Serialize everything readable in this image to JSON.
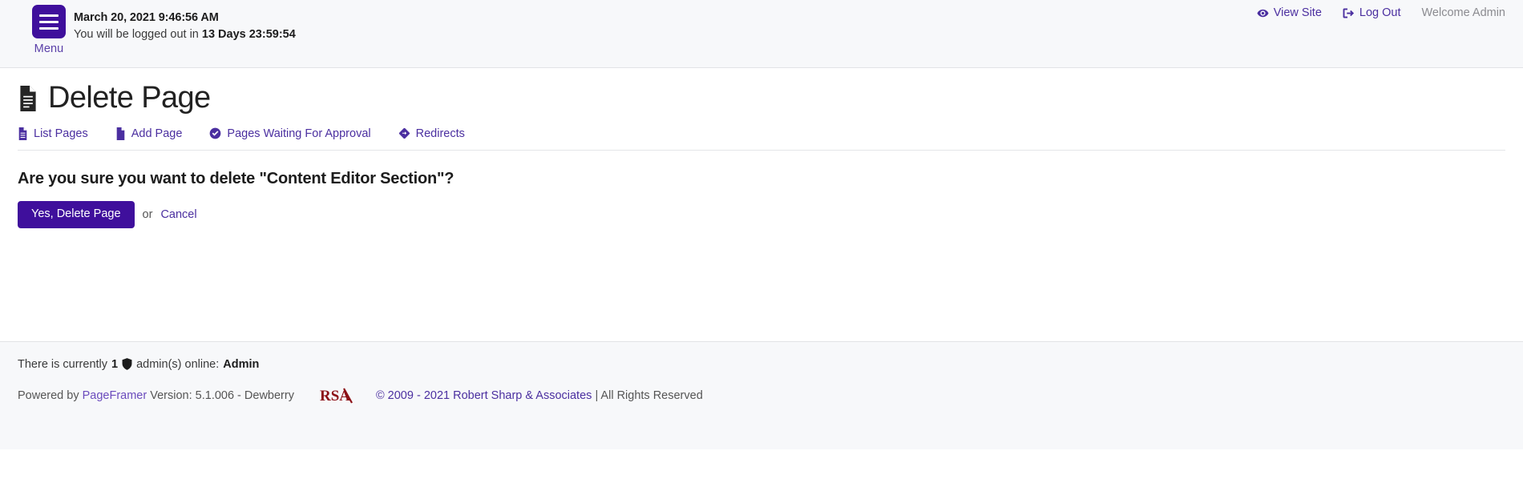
{
  "header": {
    "menu_label": "Menu",
    "menu_icon": "hamburger-menu-icon",
    "datetime": "March 20, 2021 9:46:56 AM",
    "logout_prefix": "You will be logged out in ",
    "logout_countdown": "13 Days 23:59:54",
    "view_site_label": "View Site",
    "view_site_icon": "eye-icon",
    "log_out_label": "Log Out",
    "log_out_icon": "sign-out-icon",
    "welcome_label": "Welcome Admin"
  },
  "page": {
    "title": "Delete Page",
    "title_icon": "document-icon"
  },
  "tabs": [
    {
      "label": "List Pages",
      "icon": "document-list-icon"
    },
    {
      "label": "Add Page",
      "icon": "document-add-icon"
    },
    {
      "label": "Pages Waiting For Approval",
      "icon": "check-circle-icon"
    },
    {
      "label": "Redirects",
      "icon": "diamond-arrows-icon"
    }
  ],
  "main": {
    "question": "Are you sure you want to delete \"Content Editor Section\"?",
    "confirm_button": "Yes, Delete Page",
    "or_text": "or",
    "cancel_label": "Cancel"
  },
  "footer": {
    "online_prefix": "There is currently",
    "online_count": "1",
    "online_icon": "shield-icon",
    "online_middle": "admin(s) online:",
    "online_names": "Admin",
    "powered_by": "Powered by",
    "product_name": "PageFramer",
    "version_text": "Version: 5.1.006 - Dewberry",
    "logo_text": "RSA",
    "logo_name": "rsa-logo",
    "copyright": "© 2009 - 2021 Robert Sharp & Associates",
    "rights": "| All Rights Reserved"
  },
  "colors": {
    "brand_purple": "#3f0f9c",
    "link_purple": "#4b2fa0",
    "logo_red": "#8c1016",
    "header_bg": "#f7f8fa"
  }
}
